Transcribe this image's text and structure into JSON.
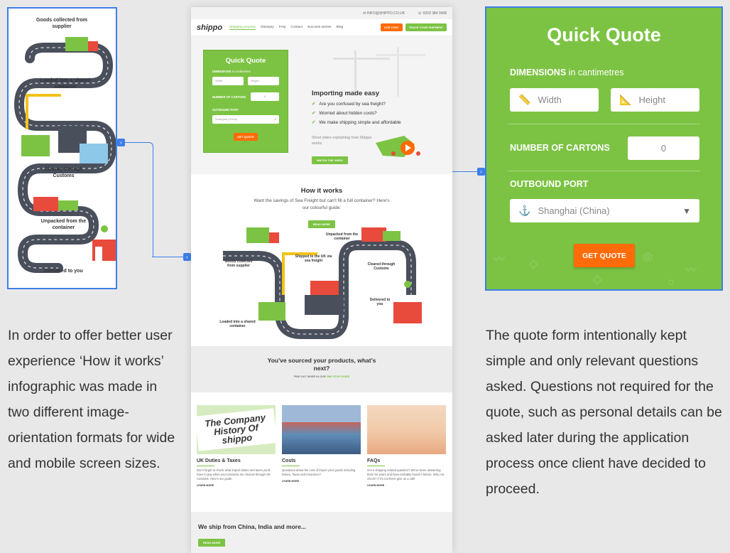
{
  "mobile_infographic": {
    "labels": [
      "Goods collected from supplier",
      "Loaded into a shared container",
      "Cleared through Customs",
      "Unpacked from the container",
      "Delivered to you"
    ]
  },
  "desc_left": "In order to offer better user experience ‘How it works’ infographic was made in two different image-orientation formats for wide and mobile screen sizes.",
  "desc_right": "The quote form intentionally kept simple and only relevant questions asked. Questions not required for the quote, such as personal details can be asked later during the application process once client have decided to proceed.",
  "site": {
    "email": "INFO@SHIPPO.CO.UK",
    "phone": "0203 384 0498",
    "logo": "shippo",
    "nav": [
      "Shipping process",
      "Glossary",
      "FAQ",
      "Contact",
      "Success stories",
      "Blog"
    ],
    "live_chat": "LIVE CHAT",
    "track": "TRACK YOUR SHIPMENT",
    "mini_quote": {
      "title": "Quick Quote",
      "dimensions": "DIMENSIONS",
      "dim_unit": "in centimetres",
      "width": "Width",
      "height": "Height",
      "cartons": "NUMBER OF CARTONS",
      "cartons_val": "0",
      "port": "OUTBOUND PORT",
      "port_val": "Shanghai (China)",
      "button": "GET QUOTE"
    },
    "hero": {
      "title": "Importing made easy",
      "points": [
        "Are you confused by sea freight?",
        "Worried about hidden costs?",
        "We make shipping simple and affordable"
      ],
      "video_text": "Short video explaining how Shippo works",
      "video_btn": "WATCH THE VIDEO"
    },
    "how": {
      "title": "How it works",
      "text": "Want the savings of Sea Freight but can't fill a full container? Here's our colourful guide:",
      "btn": "READ MORE",
      "labels": [
        "Goods collected from supplier",
        "Unpacked from the container",
        "Shipped to the UK via sea freight",
        "Cleared through Customs",
        "Delivered to you",
        "Loaded into a shared container"
      ]
    },
    "sourced": {
      "title": "You've sourced your products, what's next?",
      "sub": "FIND OUT MORE IN OUR",
      "link": "ONE STOP GUIDE"
    },
    "cards": [
      {
        "img": "The Company History Of shippo",
        "title": "UK Duties & Taxes",
        "desc": "Don't forget to check what import duties and taxes you'll have to pay when your products are cleared through UK Customs. Here's our guide.",
        "more": "LEARN MORE"
      },
      {
        "title": "Costs",
        "desc": "Questions about the cost of import your goods including Duties, Taxes and insurance?",
        "more": "LEARN MORE"
      },
      {
        "title": "FAQs",
        "desc": "Got a shipping related question? We've been answering them for years and have probably heard it before. Why not check? If it's not there give us a call!",
        "more": "LEARN MORE"
      }
    ],
    "footer": {
      "title": "We ship from China, India and more...",
      "btn": "READ MORE"
    }
  },
  "quote": {
    "title": "Quick Quote",
    "dimensions": "DIMENSIONS",
    "dim_unit": "in cantimetres",
    "width": "Width",
    "height": "Height",
    "cartons": "NUMBER OF CARTONS",
    "cartons_val": "0",
    "port": "OUTBOUND PORT",
    "port_val": "Shanghai (China)",
    "button": "GET QUOTE"
  },
  "colors": {
    "green": "#7cc343",
    "orange": "#ff6b08",
    "blue": "#3e7ee8",
    "road": "#4a4f5c"
  }
}
